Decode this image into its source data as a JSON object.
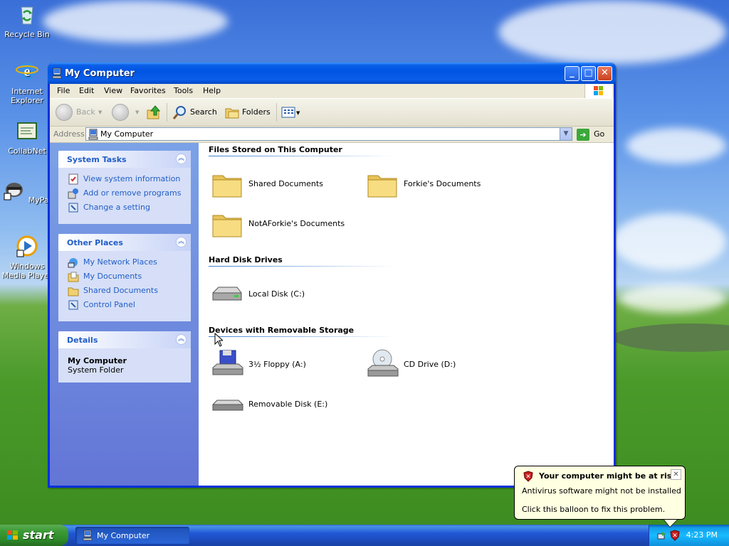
{
  "desktop": {
    "icons": [
      {
        "label": "Recycle Bin",
        "icon": "recycle-bin-icon"
      },
      {
        "label": "Internet Explorer",
        "icon": "internet-explorer-icon"
      },
      {
        "label": "CollabNet",
        "icon": "collabnet-icon"
      },
      {
        "label": "MyPal",
        "icon": "mypal-icon"
      },
      {
        "label": "Windows Media Player",
        "icon": "windows-media-player-icon"
      }
    ]
  },
  "window": {
    "title": "My Computer",
    "menu": [
      "File",
      "Edit",
      "View",
      "Favorites",
      "Tools",
      "Help"
    ],
    "toolbar": {
      "back": "Back",
      "search": "Search",
      "folders": "Folders"
    },
    "address": {
      "label": "Address",
      "value": "My Computer",
      "go": "Go"
    }
  },
  "leftpane": {
    "system_tasks": {
      "title": "System Tasks",
      "items": [
        "View system information",
        "Add or remove programs",
        "Change a setting"
      ]
    },
    "other_places": {
      "title": "Other Places",
      "items": [
        "My Network Places",
        "My Documents",
        "Shared Documents",
        "Control Panel"
      ]
    },
    "details": {
      "title": "Details",
      "name": "My Computer",
      "type": "System Folder"
    }
  },
  "content": {
    "groups": [
      {
        "title": "Files Stored on This Computer",
        "items": [
          "Shared Documents",
          "Forkie's Documents",
          "NotAForkie's Documents"
        ]
      },
      {
        "title": "Hard Disk Drives",
        "items": [
          "Local Disk (C:)"
        ]
      },
      {
        "title": "Devices with Removable Storage",
        "items": [
          "3½ Floppy (A:)",
          "CD Drive (D:)",
          "Removable Disk (E:)"
        ]
      }
    ]
  },
  "taskbar": {
    "start": "start",
    "task": "My Computer",
    "clock": "4:23 PM"
  },
  "balloon": {
    "title": "Your computer might be at risk",
    "line1": "Antivirus software might not be installed",
    "line2": "Click this balloon to fix this problem."
  },
  "colors": {
    "title_bar": "#0054e3",
    "task_pane_link": "#215dc6",
    "start_button": "#3c9b36",
    "balloon_bg": "#ffffe1"
  }
}
